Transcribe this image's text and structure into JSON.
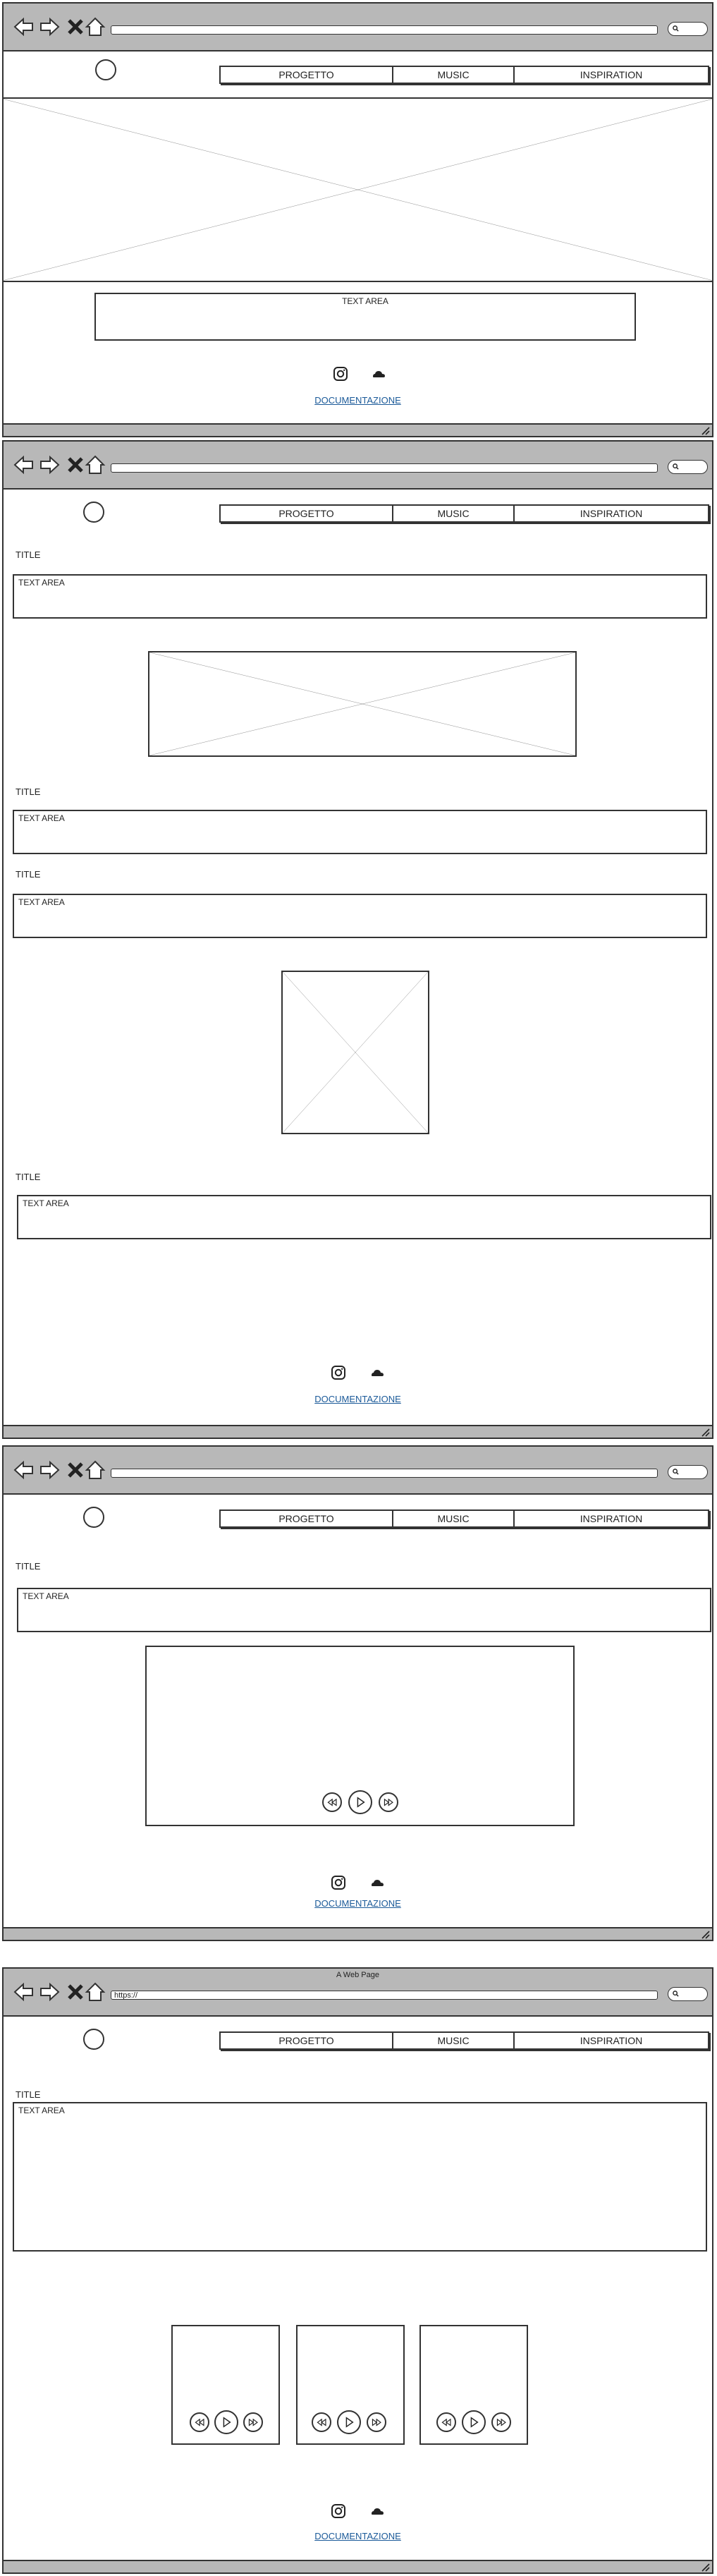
{
  "windows": [
    {
      "menu": [
        "PROGETTO",
        "MUSIC",
        "INSPIRATION"
      ],
      "textareas": [
        "TEXT AREA"
      ],
      "docs": "DOCUMENTAZIONE"
    },
    {
      "menu": [
        "PROGETTO",
        "MUSIC",
        "INSPIRATION"
      ],
      "titles": [
        "TITLE",
        "TITLE",
        "TITLE",
        "TITLE"
      ],
      "textareas": [
        "TEXT AREA",
        "TEXT AREA",
        "TEXT AREA",
        "TEXT AREA"
      ],
      "docs": "DOCUMENTAZIONE"
    },
    {
      "menu": [
        "PROGETTO",
        "MUSIC",
        "INSPIRATION"
      ],
      "titles": [
        "TITLE"
      ],
      "textareas": [
        "TEXT AREA"
      ],
      "docs": "DOCUMENTAZIONE"
    },
    {
      "window_title": "A Web Page",
      "url": "https://",
      "menu": [
        "PROGETTO",
        "MUSIC",
        "INSPIRATION"
      ],
      "titles": [
        "TITLE"
      ],
      "textareas": [
        "TEXT AREA"
      ],
      "docs": "DOCUMENTAZIONE"
    }
  ],
  "icons": {
    "back": "back-arrow-icon",
    "forward": "forward-arrow-icon",
    "stop": "close-icon",
    "home": "home-icon",
    "search": "search-icon",
    "instagram": "instagram-icon",
    "soundcloud": "soundcloud-icon",
    "rewind": "rewind-icon",
    "play": "play-icon",
    "fastforward": "fast-forward-icon"
  },
  "colors": {
    "chrome": "#b8b8b8",
    "link": "#1b5a99"
  }
}
